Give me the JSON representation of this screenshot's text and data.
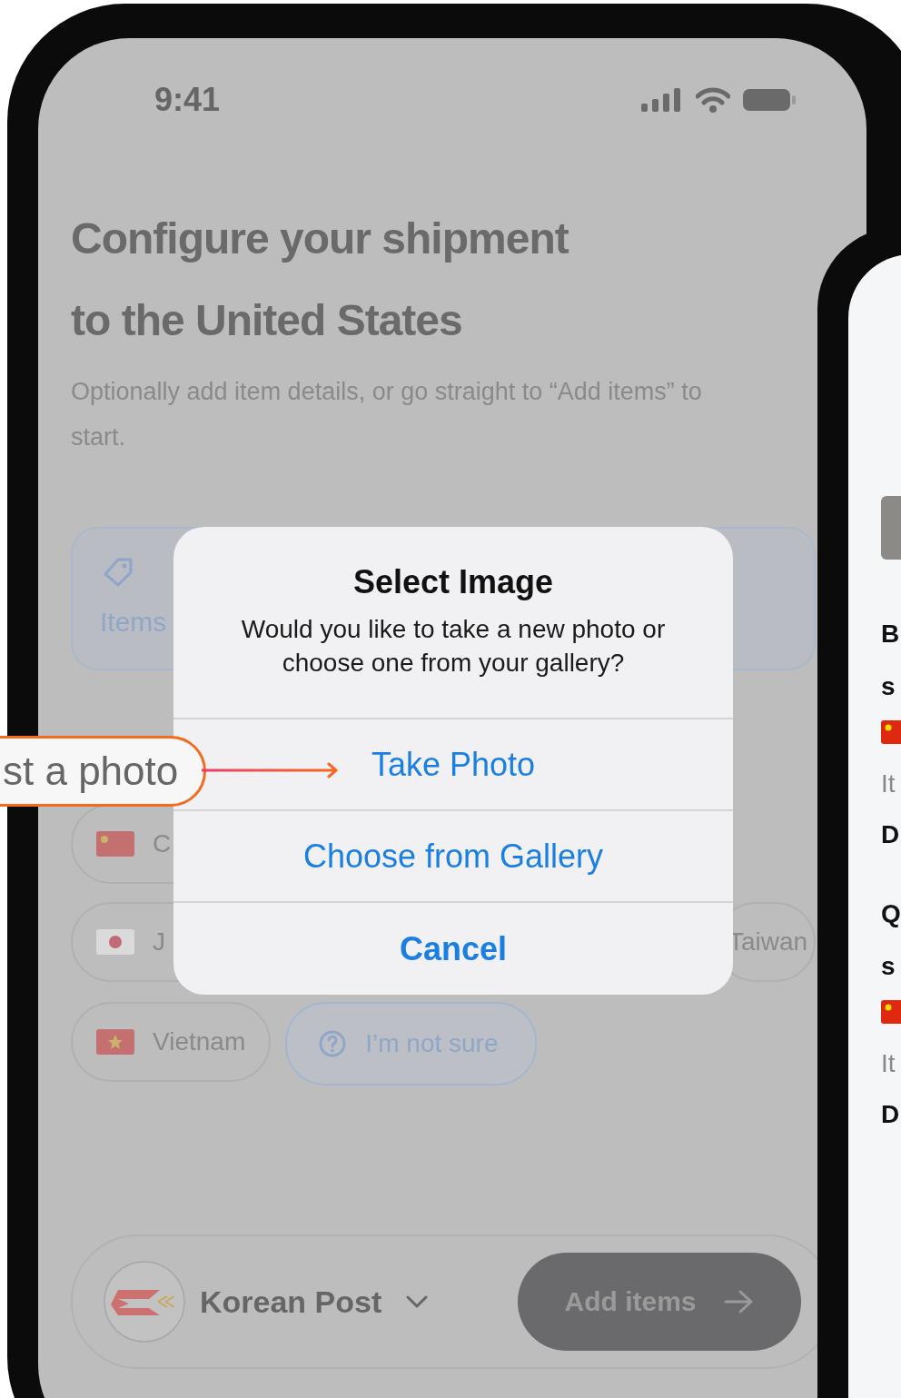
{
  "status_bar": {
    "time": "9:41"
  },
  "heading": {
    "title": "Configure your shipment to the United States",
    "subtitle": "Optionally add item details, or go straight to “Add items” to start."
  },
  "category_card": {
    "label": "Items"
  },
  "origin_chip_rows": [
    [
      {
        "label": "C",
        "kind": "china"
      }
    ],
    [
      {
        "label": "J",
        "kind": "japan"
      },
      {
        "label": "Taiwan",
        "kind": "taiwan"
      }
    ],
    [
      {
        "label": "Vietnam",
        "kind": "vietnam"
      },
      {
        "label": "I’m not sure",
        "kind": "unsure"
      }
    ]
  ],
  "carrier": {
    "name": "Korean Post"
  },
  "add_button": {
    "label": "Add items"
  },
  "dialog": {
    "title": "Select Image",
    "message": "Would you like to take a new photo or choose one from your gallery?",
    "actions": [
      {
        "label": "Take Photo",
        "kind": "default"
      },
      {
        "label": "Choose from Gallery",
        "kind": "default"
      },
      {
        "label": "Cancel",
        "kind": "cancel"
      }
    ]
  },
  "callout": {
    "text": "st a photo"
  },
  "side_phone": {
    "items": [
      {
        "title_lines": [
          "B",
          "s"
        ],
        "label": "It",
        "value": "D"
      },
      {
        "title_lines": [
          "Q",
          "s"
        ],
        "label": "It",
        "value": "D"
      }
    ]
  }
}
